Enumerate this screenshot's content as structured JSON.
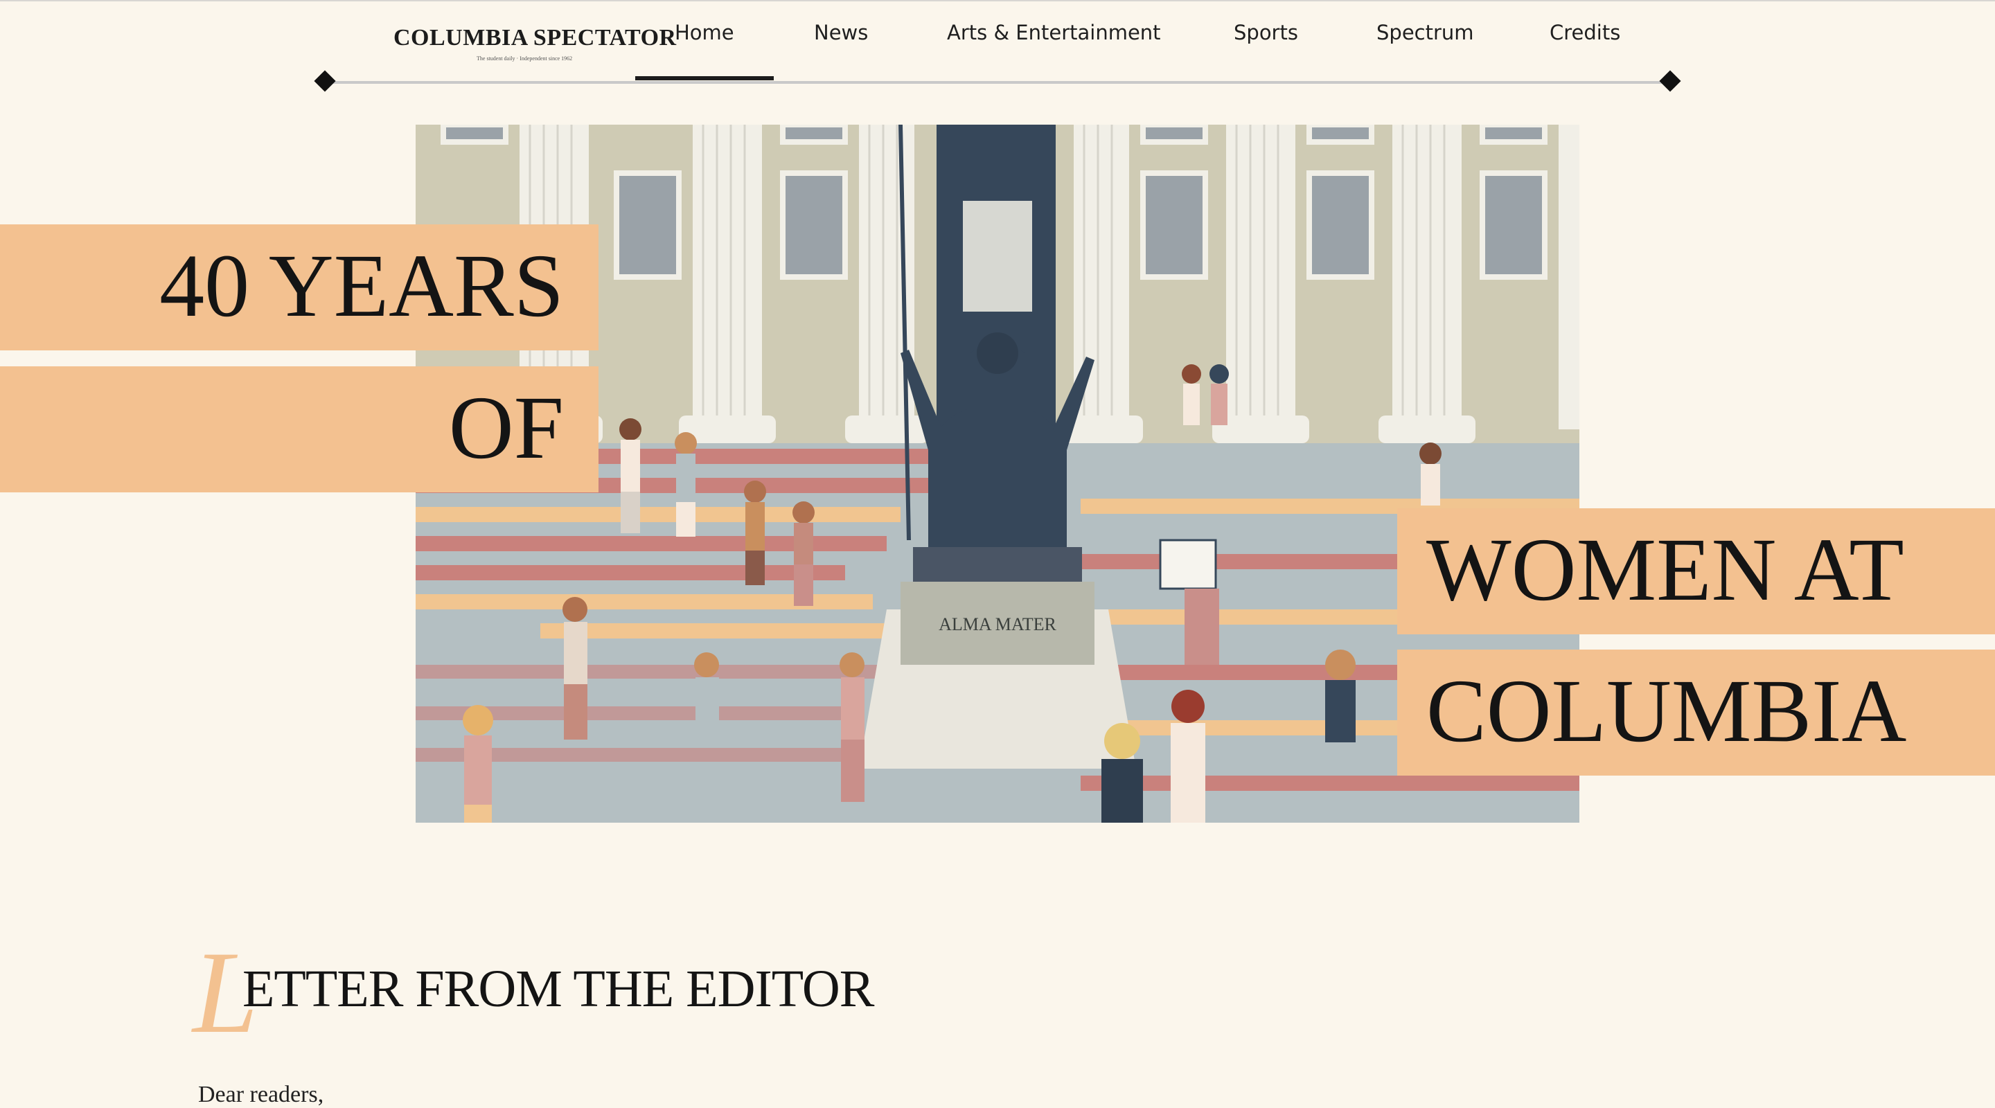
{
  "header": {
    "logo_text": "COLUMBIA SPECTATOR",
    "logo_tagline": "The student daily · Independent since 1962",
    "nav": [
      {
        "label": "Home"
      },
      {
        "label": "News"
      },
      {
        "label": "Arts & Entertainment"
      },
      {
        "label": "Sports"
      },
      {
        "label": "Spectrum"
      },
      {
        "label": "Credits"
      }
    ],
    "active_nav": "Home"
  },
  "hero": {
    "title_lines": [
      "40 YEARS",
      "OF",
      "WOMEN AT",
      "COLUMBIA"
    ],
    "statue_plaque": "ALMA MATER",
    "banner_color": "#f3c190"
  },
  "letter": {
    "drop_cap": "L",
    "title_rest": "ETTER FROM THE EDITOR",
    "body_start": "Dear readers,"
  },
  "colors": {
    "background": "#fbf6ec",
    "accent": "#f3c190",
    "text": "#141414",
    "building": "#cfcbb4",
    "stairs_pink": "#c9817c",
    "stairs_gray": "#b4bfc2",
    "stairs_peach": "#f1c590",
    "statue": "#36475a"
  }
}
